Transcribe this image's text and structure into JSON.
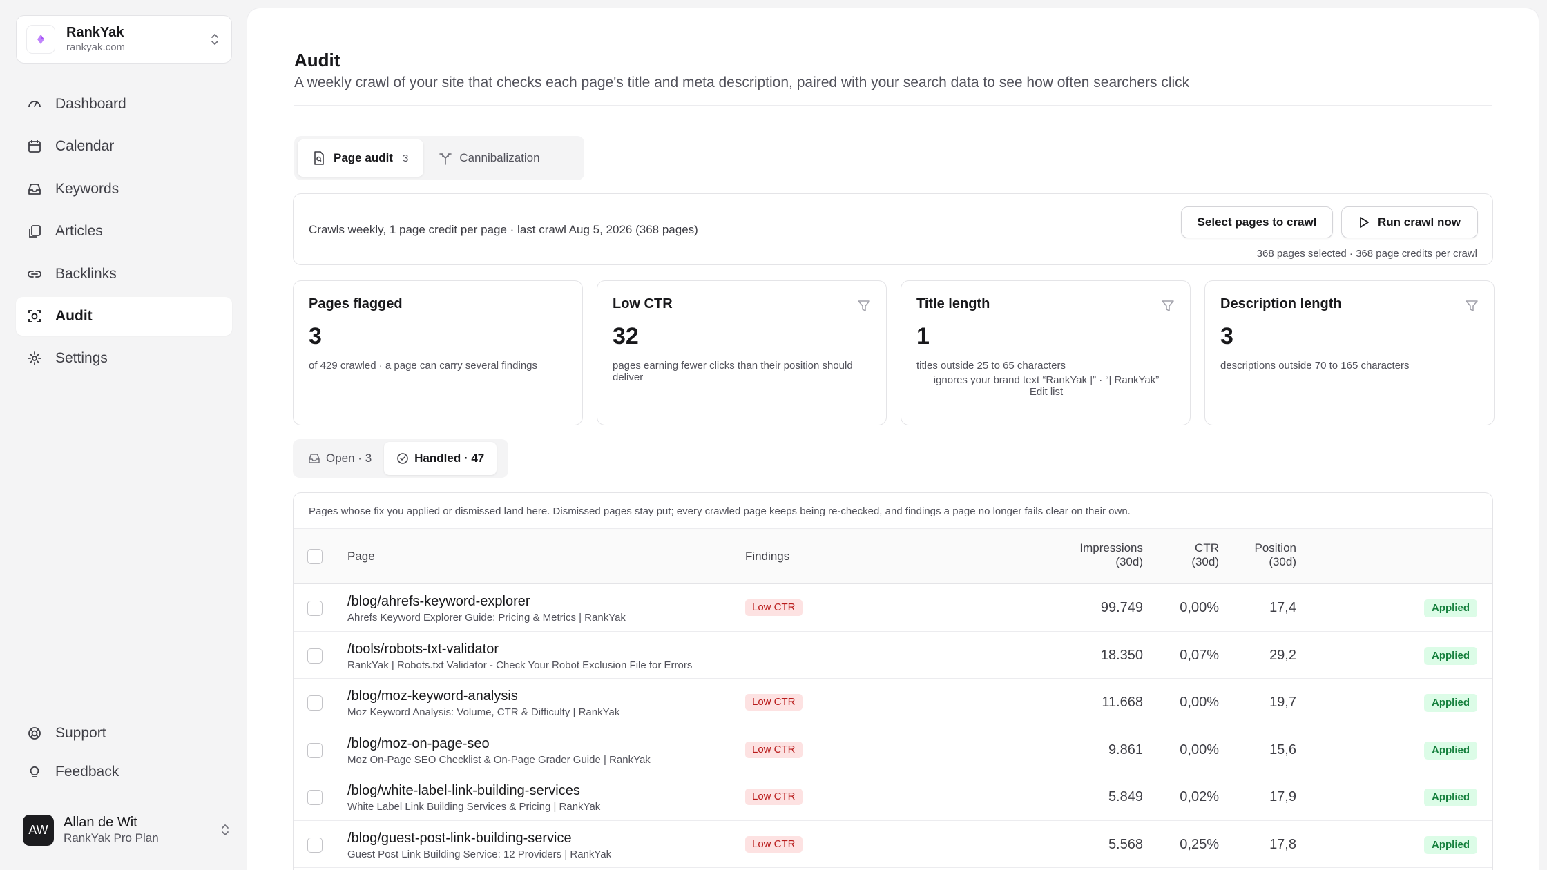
{
  "workspace": {
    "name": "RankYak",
    "domain": "rankyak.com"
  },
  "nav": {
    "items": [
      {
        "label": "Dashboard",
        "icon": "gauge-icon"
      },
      {
        "label": "Calendar",
        "icon": "calendar-icon"
      },
      {
        "label": "Keywords",
        "icon": "inbox-icon"
      },
      {
        "label": "Articles",
        "icon": "document-stack-icon"
      },
      {
        "label": "Backlinks",
        "icon": "link-icon"
      },
      {
        "label": "Audit",
        "icon": "scan-icon",
        "active": true
      },
      {
        "label": "Settings",
        "icon": "gear-icon"
      }
    ],
    "bottom": [
      {
        "label": "Support",
        "icon": "lifebuoy-icon"
      },
      {
        "label": "Feedback",
        "icon": "lightbulb-icon"
      }
    ]
  },
  "user": {
    "initials": "AW",
    "name": "Allan de Wit",
    "plan": "RankYak Pro Plan"
  },
  "page": {
    "title": "Audit",
    "subtitle": "A weekly crawl of your site that checks each page's title and meta description, paired with your search data to see how often searchers click"
  },
  "tabs": [
    {
      "label": "Page audit",
      "count": "3",
      "active": true
    },
    {
      "label": "Cannibalization"
    }
  ],
  "crawl": {
    "info": "Crawls weekly, 1 page credit per page · last crawl Aug 5, 2026 (368 pages)",
    "select_label": "Select pages to crawl",
    "run_label": "Run crawl now",
    "meta": "368 pages selected · 368 page credits per crawl"
  },
  "cards": [
    {
      "title": "Pages flagged",
      "value": "3",
      "desc": "of 429 crawled · a page can carry several findings"
    },
    {
      "title": "Low CTR",
      "value": "32",
      "desc": "pages earning fewer clicks than their position should deliver"
    },
    {
      "title": "Title length",
      "value": "1",
      "desc": "titles outside 25 to 65 characters",
      "note": "ignores your brand text “RankYak |” · “| RankYak”",
      "link": "Edit list"
    },
    {
      "title": "Description length",
      "value": "3",
      "desc": "descriptions outside 70 to 165 characters"
    }
  ],
  "status_tabs": [
    {
      "label": "Open · 3"
    },
    {
      "label": "Handled · 47",
      "active": true
    }
  ],
  "table": {
    "note": "Pages whose fix you applied or dismissed land here. Dismissed pages stay put; every crawled page keeps being re-checked, and findings a page no longer fails clear on their own.",
    "headers": {
      "page": "Page",
      "findings": "Findings",
      "impressions": "Impressions",
      "impressions_sub": "(30d)",
      "ctr": "CTR",
      "ctr_sub": "(30d)",
      "position": "Position",
      "position_sub": "(30d)"
    },
    "rows": [
      {
        "path": "/blog/ahrefs-keyword-explorer",
        "title": "Ahrefs Keyword Explorer Guide: Pricing & Metrics | RankYak",
        "finding": "Low CTR",
        "impressions": "99.749",
        "ctr": "0,00%",
        "position": "17,4",
        "status": "Applied"
      },
      {
        "path": "/tools/robots-txt-validator",
        "title": "RankYak | Robots.txt Validator - Check Your Robot Exclusion File for Errors",
        "finding": "",
        "impressions": "18.350",
        "ctr": "0,07%",
        "position": "29,2",
        "status": "Applied"
      },
      {
        "path": "/blog/moz-keyword-analysis",
        "title": "Moz Keyword Analysis: Volume, CTR & Difficulty | RankYak",
        "finding": "Low CTR",
        "impressions": "11.668",
        "ctr": "0,00%",
        "position": "19,7",
        "status": "Applied"
      },
      {
        "path": "/blog/moz-on-page-seo",
        "title": "Moz On-Page SEO Checklist & On-Page Grader Guide | RankYak",
        "finding": "Low CTR",
        "impressions": "9.861",
        "ctr": "0,00%",
        "position": "15,6",
        "status": "Applied"
      },
      {
        "path": "/blog/white-label-link-building-services",
        "title": "White Label Link Building Services & Pricing | RankYak",
        "finding": "Low CTR",
        "impressions": "5.849",
        "ctr": "0,02%",
        "position": "17,9",
        "status": "Applied"
      },
      {
        "path": "/blog/guest-post-link-building-service",
        "title": "Guest Post Link Building Service: 12 Providers | RankYak",
        "finding": "Low CTR",
        "impressions": "5.568",
        "ctr": "0,25%",
        "position": "17,8",
        "status": "Applied"
      }
    ]
  },
  "colors": {
    "accent": "#a855f7",
    "danger_bg": "#fde2e2",
    "danger_text": "#b91c1c",
    "success_bg": "#dcfce7",
    "success_text": "#15803d"
  }
}
